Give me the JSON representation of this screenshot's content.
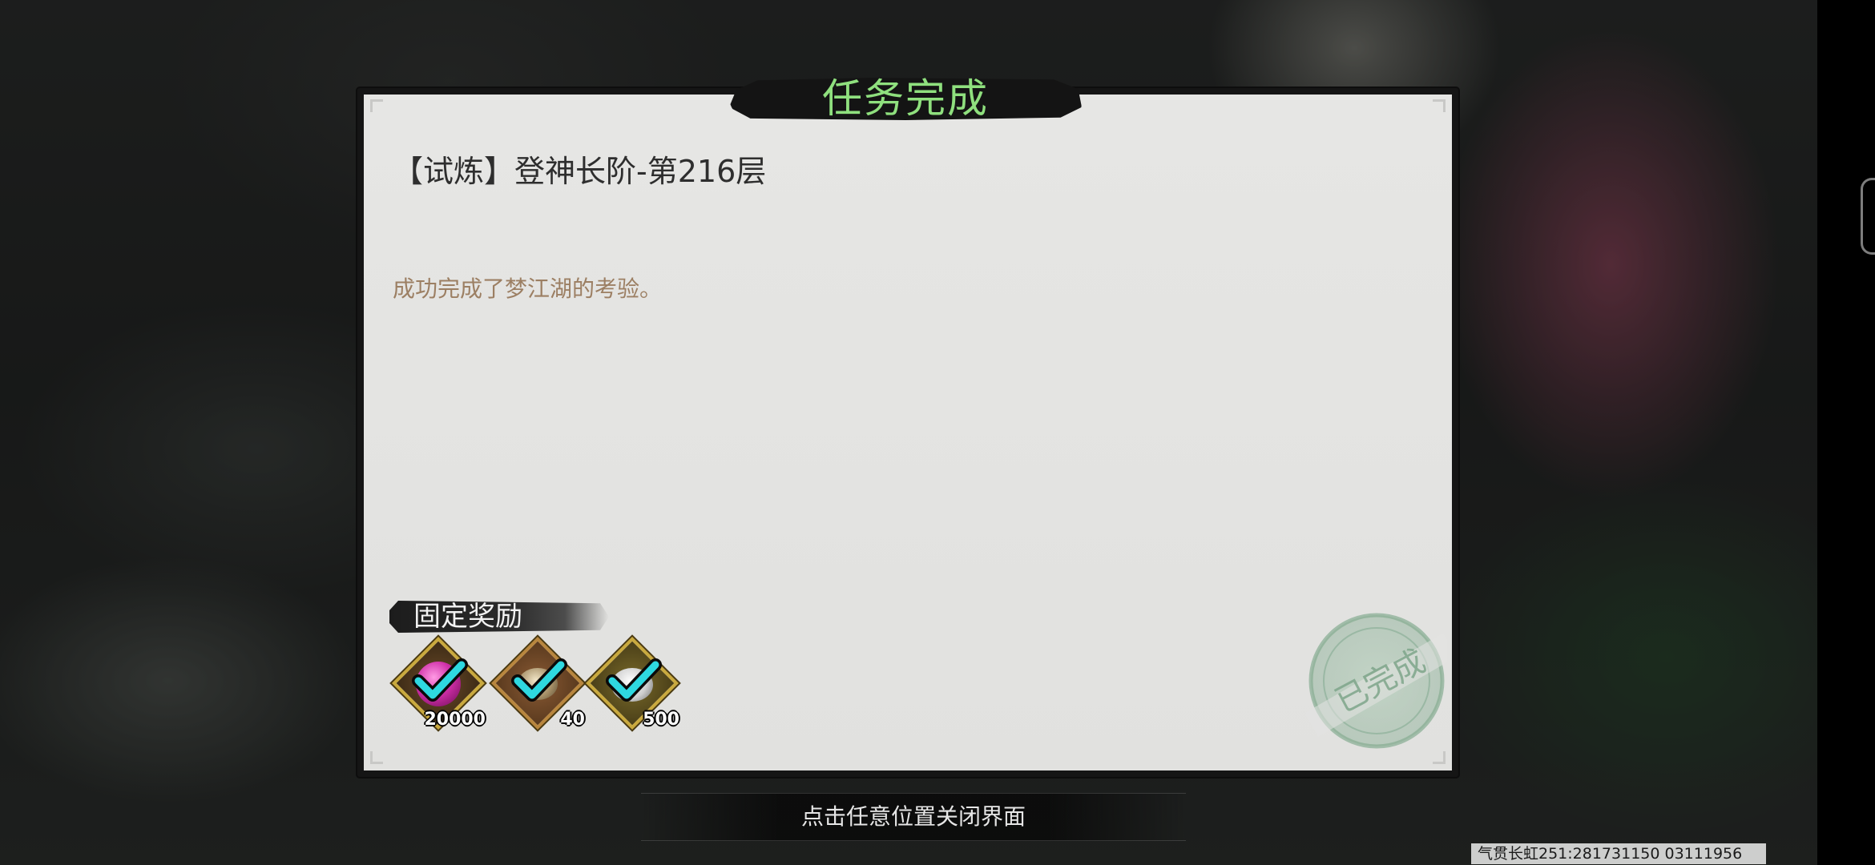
{
  "dialog": {
    "title": "任务完成",
    "quest_name": "【试炼】登神长阶-第216层",
    "description": "成功完成了梦江湖的考验。",
    "status_stamp": "已完成"
  },
  "rewards": {
    "heading": "固定奖励",
    "items": [
      {
        "icon": "pink-orb-icon",
        "quantity": "20000",
        "claimed": true
      },
      {
        "icon": "ore-icon",
        "quantity": "40",
        "claimed": true
      },
      {
        "icon": "silver-ingot-icon",
        "quantity": "500",
        "claimed": true
      }
    ]
  },
  "footer": {
    "close_hint": "点击任意位置关闭界面"
  },
  "overlay": {
    "player_info": "气贯长虹251:281731150 03111956"
  },
  "colors": {
    "title": "#8fe07e",
    "description": "#9c7f63",
    "check": "#2ed8e0",
    "stamp": "#8fb39a"
  }
}
